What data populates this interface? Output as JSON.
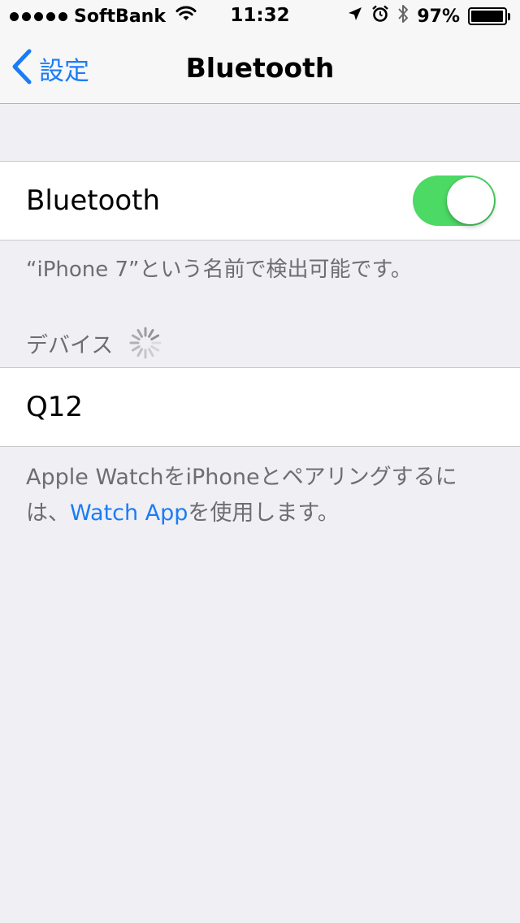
{
  "status_bar": {
    "carrier": "SoftBank",
    "time": "11:32",
    "battery_percent": "97%",
    "battery_level": 0.97,
    "icons": [
      "signal-dots-icon",
      "wifi-icon",
      "location-arrow-icon",
      "alarm-icon",
      "bluetooth-icon",
      "battery-icon"
    ]
  },
  "nav": {
    "back_label": "設定",
    "title": "Bluetooth"
  },
  "bluetooth_toggle": {
    "label": "Bluetooth",
    "on": true
  },
  "discoverable_text": "“iPhone 7”という名前で検出可能です。",
  "devices_section": {
    "header": "デバイス",
    "searching": true,
    "items": [
      {
        "name": "Q12"
      }
    ]
  },
  "watch_footer": {
    "line1": "Apple WatchをiPhoneとペアリングするに",
    "line2_prefix": "は、",
    "link": "Watch App",
    "line2_suffix": "を使用します。"
  },
  "colors": {
    "accent": "#1b7cf5",
    "toggle_on": "#4cd964",
    "background": "#efeff4",
    "secondary_text": "#6d6d72"
  }
}
